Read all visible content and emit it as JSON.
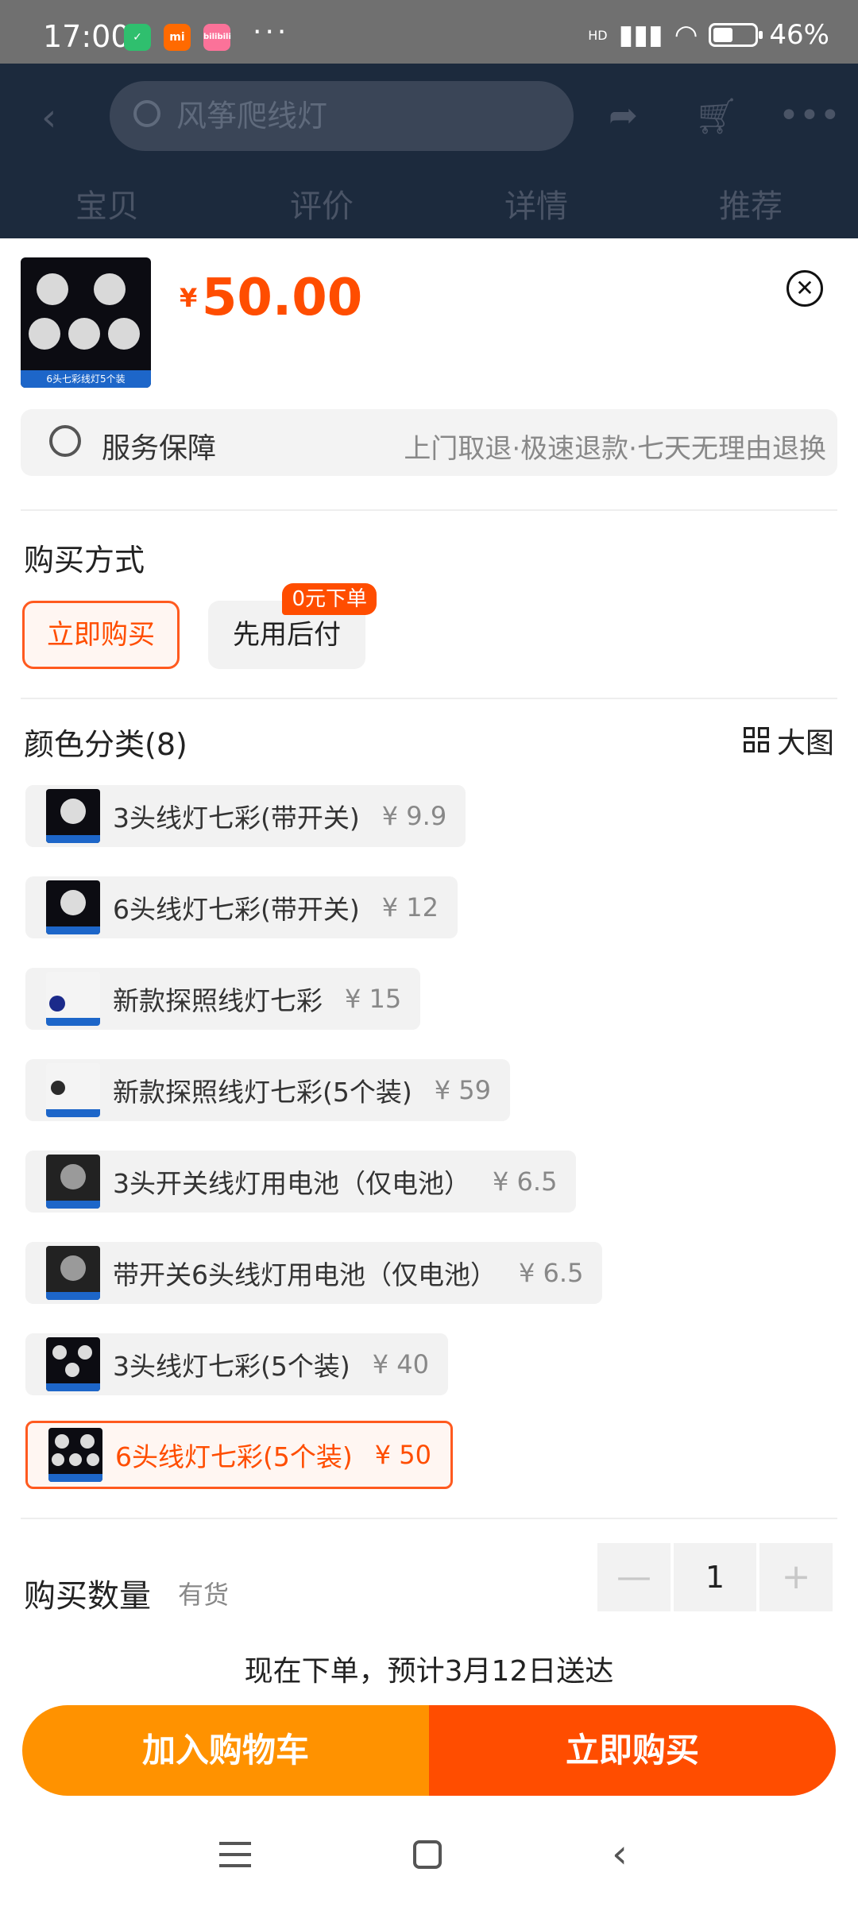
{
  "status_bar": {
    "time": "17:00",
    "app_icons": [
      "mi",
      "bilibili"
    ],
    "dots": "···",
    "network": "HD",
    "battery_percent": "46%",
    "battery_level": 0.46
  },
  "header": {
    "search_placeholder": "风筝爬线灯",
    "tabs": [
      "宝贝",
      "评价",
      "详情",
      "推荐"
    ]
  },
  "product": {
    "thumb_caption": "6头七彩线灯5个装",
    "price_symbol": "¥",
    "price": "50.00"
  },
  "service": {
    "label": "服务保障",
    "desc": "上门取退·极速退款·七天无理由退换"
  },
  "purchase_method": {
    "title": "购买方式",
    "options": [
      "立即购买",
      "先用后付"
    ],
    "badge": "0元下单"
  },
  "color_category": {
    "title": "颜色分类(8)",
    "big_pic_label": "大图",
    "variants": [
      {
        "name": "3头线灯七彩(带开关)",
        "price": "¥ 9.9"
      },
      {
        "name": "6头线灯七彩(带开关)",
        "price": "¥ 12"
      },
      {
        "name": "新款探照线灯七彩",
        "price": "¥ 15"
      },
      {
        "name": "新款探照线灯七彩(5个装)",
        "price": "¥ 59"
      },
      {
        "name": "3头开关线灯用电池（仅电池）",
        "price": "¥ 6.5"
      },
      {
        "name": "带开关6头线灯用电池（仅电池）",
        "price": "¥ 6.5"
      },
      {
        "name": "3头线灯七彩(5个装)",
        "price": "¥ 40"
      },
      {
        "name": "6头线灯七彩(5个装)",
        "price": "¥ 50"
      }
    ]
  },
  "quantity": {
    "label": "购买数量",
    "stock": "有货",
    "minus": "—",
    "value": "1",
    "plus": "+"
  },
  "delivery": "现在下单，预计3月12日送达",
  "actions": {
    "add_to_cart": "加入购物车",
    "buy_now": "立即购买"
  },
  "colors": {
    "accent": "#ff4d00",
    "cart": "#ff9200"
  }
}
